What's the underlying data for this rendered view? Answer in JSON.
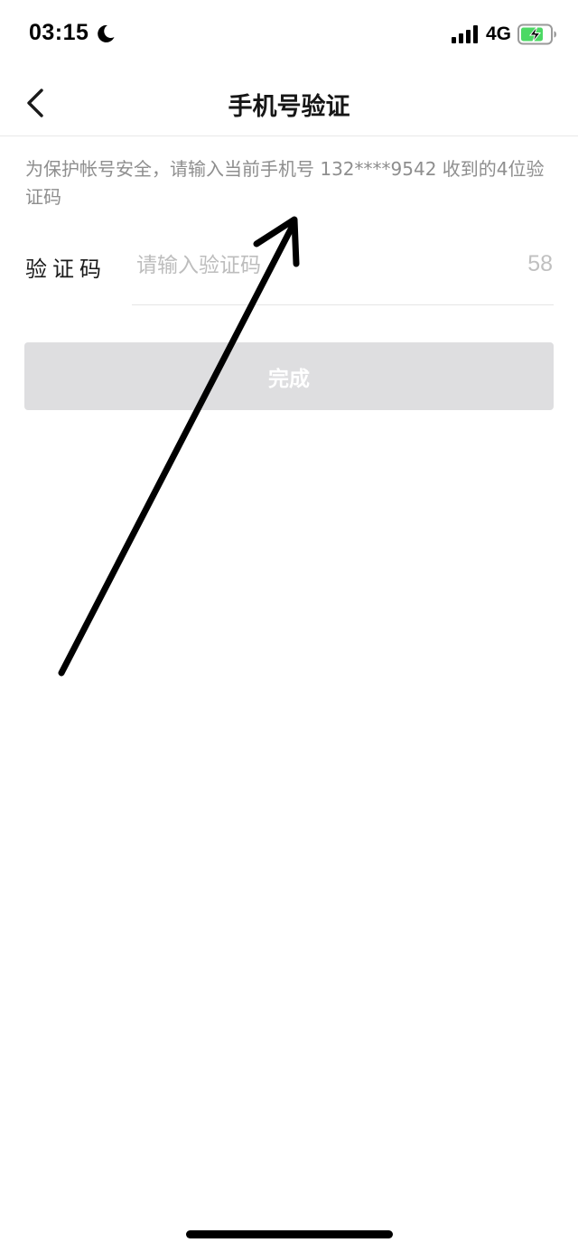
{
  "status_bar": {
    "time": "03:15",
    "network": "4G",
    "icons": [
      "moon-icon",
      "signal-icon",
      "battery-charging-icon"
    ]
  },
  "nav": {
    "title": "手机号验证",
    "back_icon": "chevron-left-icon"
  },
  "description": "为保护帐号安全，请输入当前手机号 132****9542 收到的4位验证码",
  "form": {
    "code_label": "验证码",
    "code_placeholder": "请输入验证码",
    "code_value": "",
    "countdown": "58"
  },
  "done_button": {
    "label": "完成"
  },
  "colors": {
    "button_disabled": "#dedee0",
    "hint_text": "#8e8e8e",
    "placeholder": "#bdbdbd",
    "battery_green": "#4cd964"
  }
}
